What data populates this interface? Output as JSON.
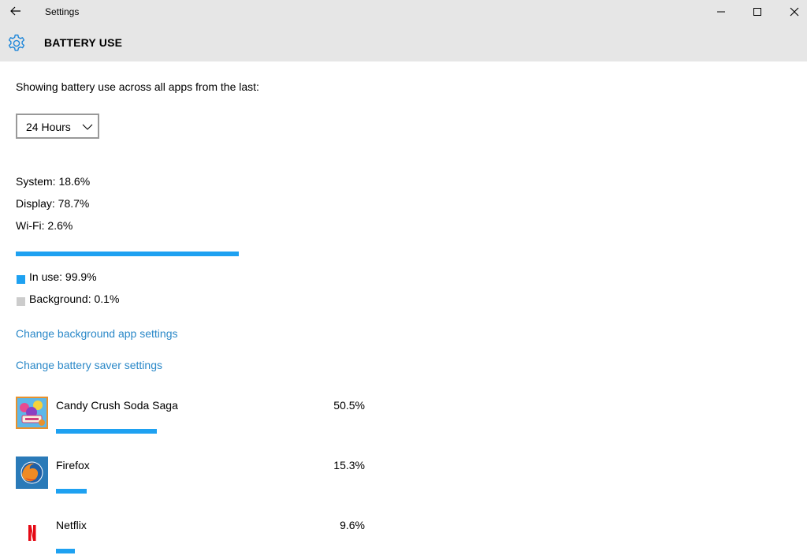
{
  "window": {
    "title": "Settings"
  },
  "header": {
    "title": "BATTERY USE"
  },
  "main": {
    "intro": "Showing battery use across all apps from the last:",
    "period": {
      "selected": "24 Hours"
    },
    "breakdown": [
      {
        "label": "System: 18.6%"
      },
      {
        "label": "Display: 78.7%"
      },
      {
        "label": "Wi-Fi: 2.6%"
      }
    ],
    "usage": {
      "in_use_fraction": 0.999,
      "legend": [
        {
          "label": "In use: 99.9%",
          "color": "#1ea1f1"
        },
        {
          "label": "Background: 0.1%",
          "color": "#cccccc"
        }
      ]
    },
    "links": {
      "background_apps": "Change background app settings",
      "battery_saver": "Change battery saver settings"
    },
    "apps": [
      {
        "name": "Candy Crush Soda Saga",
        "percent": "50.5%",
        "icon": "candy-crush-icon",
        "share": 0.505
      },
      {
        "name": "Firefox",
        "percent": "15.3%",
        "icon": "firefox-icon",
        "share": 0.153
      },
      {
        "name": "Netflix",
        "percent": "9.6%",
        "icon": "netflix-icon",
        "share": 0.096
      }
    ]
  },
  "colors": {
    "accent": "#1ea1f1",
    "link": "#2a88c8",
    "chrome": "#e6e6e6"
  }
}
